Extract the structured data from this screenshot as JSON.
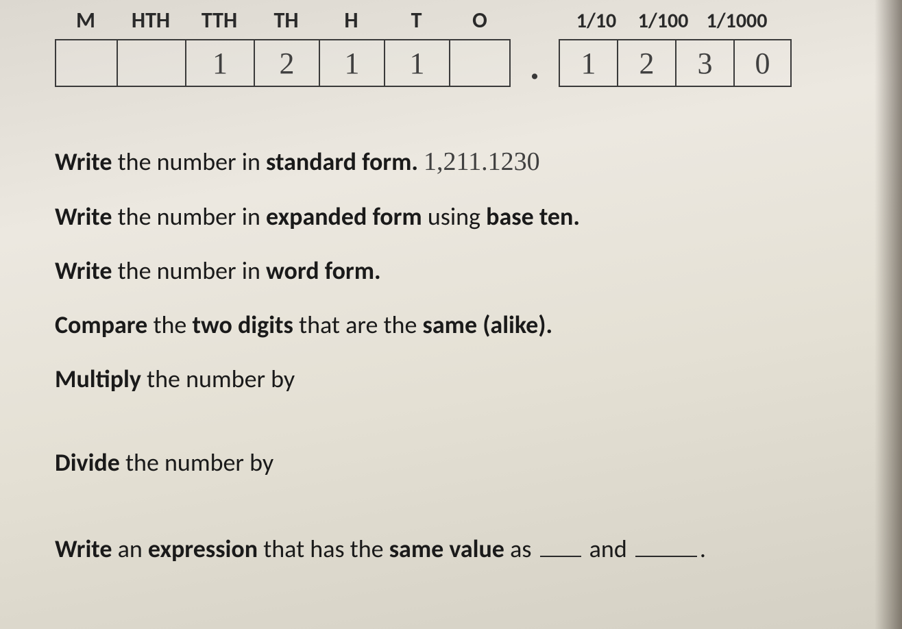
{
  "headers": {
    "m": "M",
    "hth": "HTH",
    "tth": "TTH",
    "th": "TH",
    "h": "H",
    "t": "T",
    "o": "O",
    "f1": "1/10",
    "f2": "1/100",
    "f3": "1/1000"
  },
  "place_values": {
    "m": "",
    "hth": "",
    "tth": "1",
    "th": "2",
    "h": "1",
    "t": "1",
    "o": "",
    "decimal": ".",
    "f1": "1",
    "f2": "2",
    "f3": "3",
    "f4": "0"
  },
  "questions": {
    "q1_prefix": "Write",
    "q1_mid": " the number in ",
    "q1_bold": "standard form.",
    "q1_answer": "1,211.1230",
    "q2_prefix": "Write",
    "q2_mid": " the number in ",
    "q2_bold1": "expanded form",
    "q2_mid2": " using ",
    "q2_bold2": "base ten.",
    "q3_prefix": "Write",
    "q3_mid": " the number in ",
    "q3_bold": "word form.",
    "q4_prefix": "Compare",
    "q4_mid": " the ",
    "q4_bold1": "two digits",
    "q4_mid2": " that are the ",
    "q4_bold2": "same (alike).",
    "q5_prefix": "Multiply",
    "q5_mid": " the number by",
    "q6_prefix": "Divide",
    "q6_mid": " the number by",
    "q7_prefix": "Write",
    "q7_mid": " an ",
    "q7_bold1": "expression",
    "q7_mid2": " that has the ",
    "q7_bold2": "same value",
    "q7_mid3": " as ",
    "q7_and": " and ",
    "q7_period": "."
  }
}
